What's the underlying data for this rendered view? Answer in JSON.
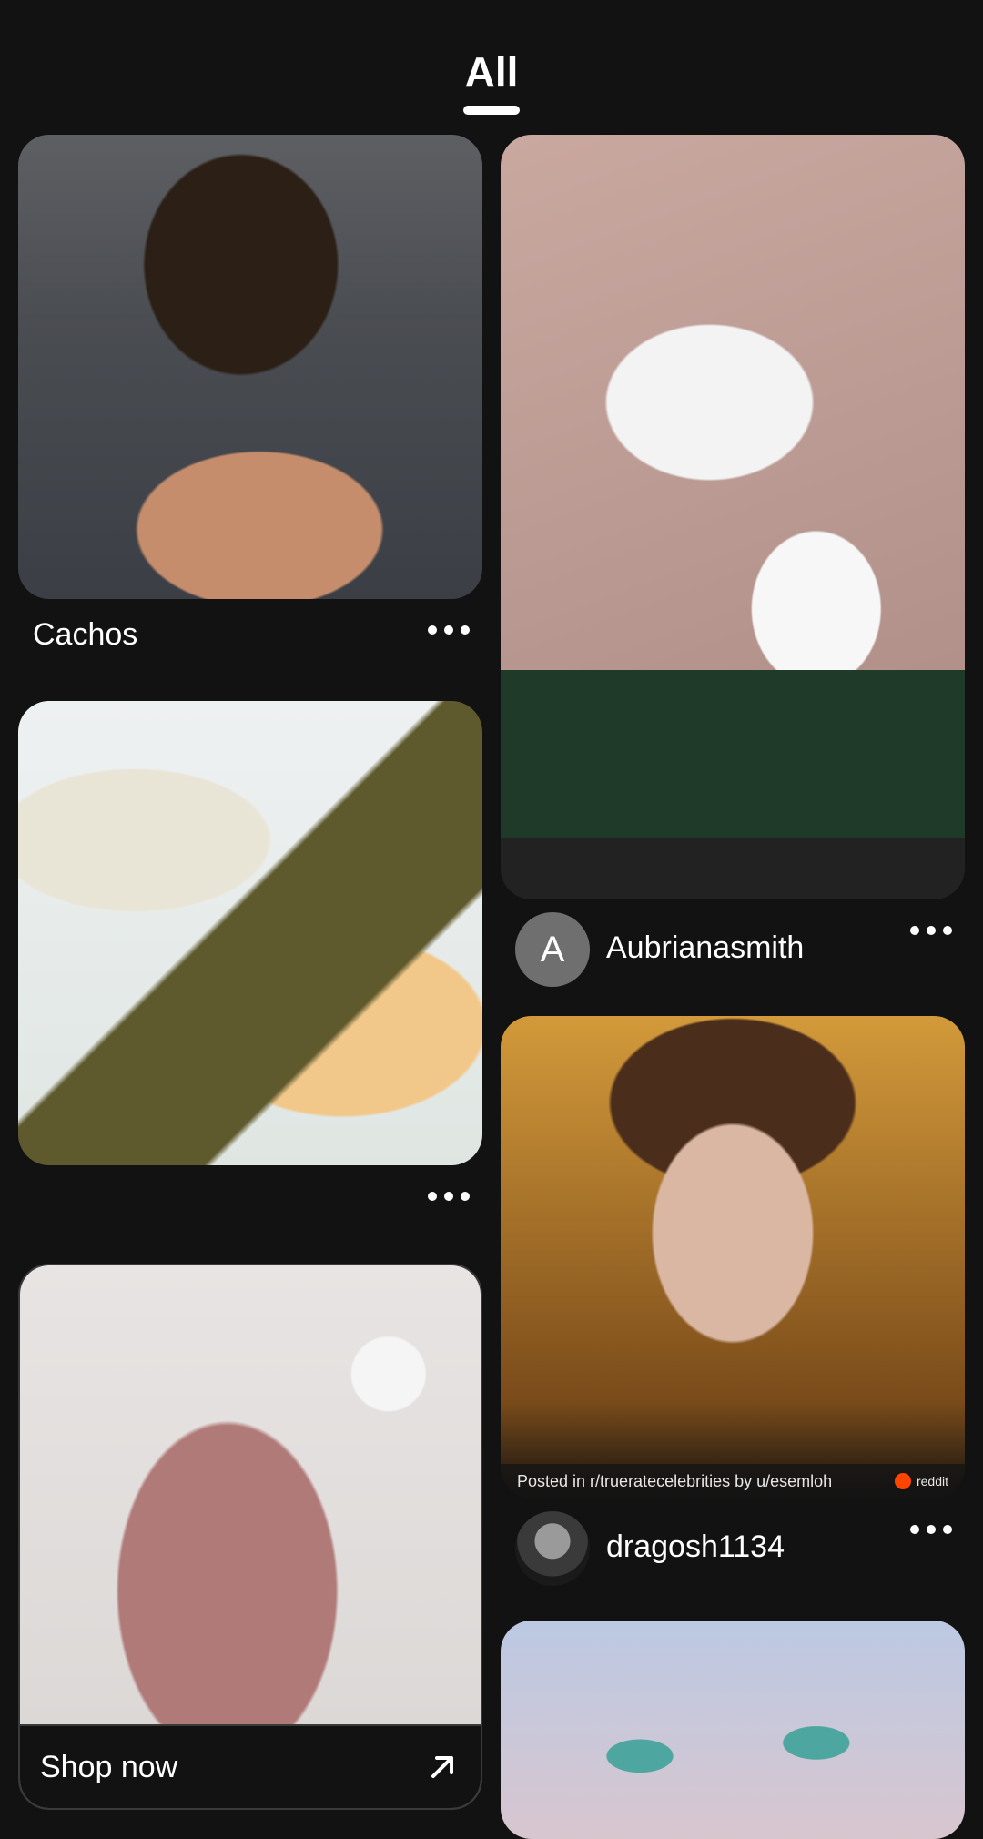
{
  "tabs": [
    {
      "label": "All",
      "active": true
    }
  ],
  "left_column": {
    "pins": [
      {
        "title": "Cachos",
        "image": "curly-hair-man-photo"
      },
      {
        "title": "",
        "image": "anime-illustration"
      },
      {
        "image": "pink-pajama-set-photo",
        "cta": "Shop now",
        "cta_icon": "arrow-up-right-icon"
      }
    ]
  },
  "right_column": {
    "pins": [
      {
        "image": "bathroom-video-frame",
        "user": {
          "name": "Aubrianasmith",
          "avatar_letter": "A",
          "avatar_color": "#6f6f6f"
        }
      },
      {
        "image": "man-portrait-photo",
        "caption": {
          "text": "Posted in r/trueratecelebrities by u/esemloh",
          "brand": "reddit"
        },
        "user": {
          "name": "dragosh1134"
        }
      },
      {
        "image": "face-closeup-photo"
      }
    ]
  },
  "colors": {
    "background": "#121212",
    "text": "#ffffff"
  }
}
